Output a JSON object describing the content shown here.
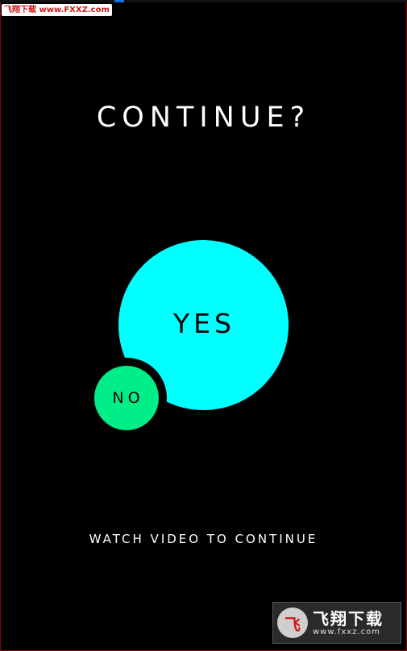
{
  "watermark_top": "飞翔下载 www.FXXZ.com",
  "screen": {
    "title": "CONTINUE?",
    "yes_label": "YES",
    "no_label": "NO",
    "watch_label": "WATCH VIDEO TO CONTINUE"
  },
  "watermark_bottom": {
    "logo_glyph": "飞",
    "name": "飞翔下载",
    "url": "www.fxxz.com"
  },
  "colors": {
    "background": "#000000",
    "yes": "#00ffff",
    "no": "#00ee88",
    "text": "#ffffff"
  }
}
